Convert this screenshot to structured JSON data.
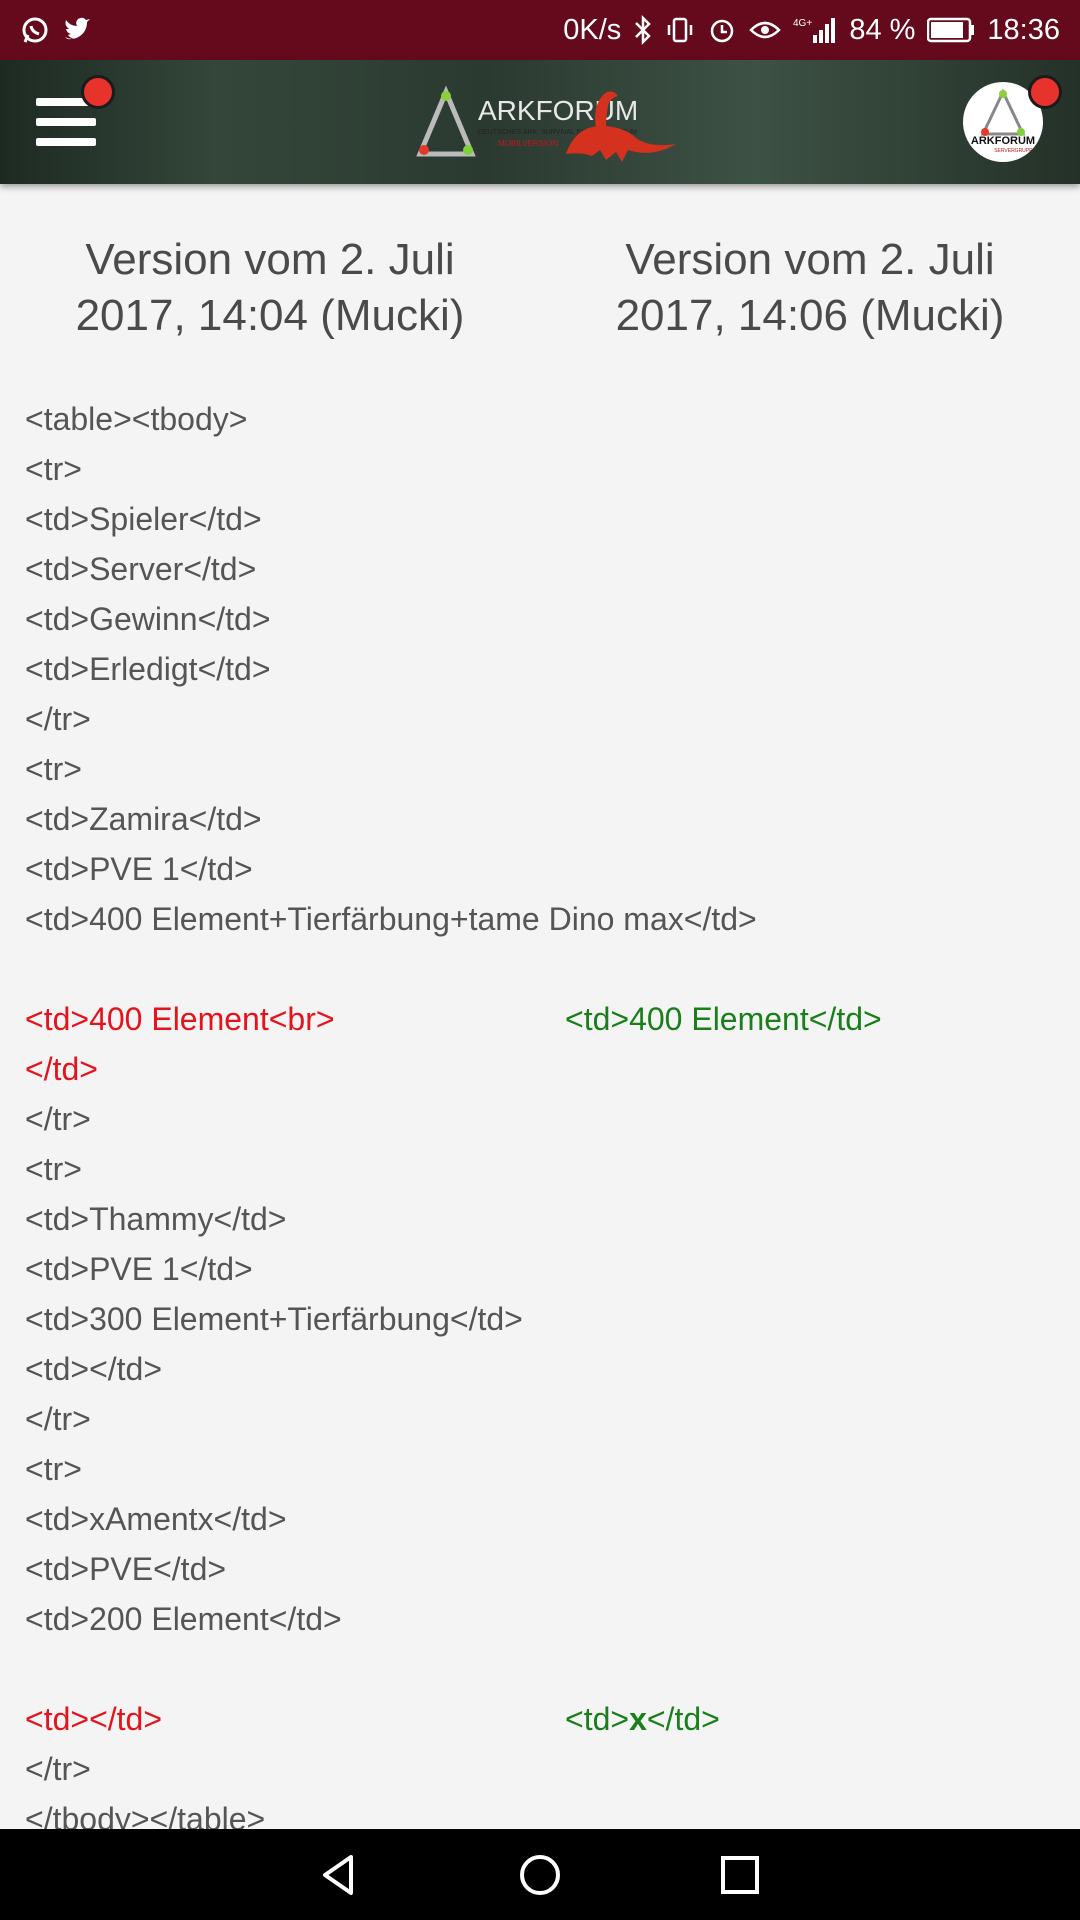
{
  "status_bar": {
    "left_icons": [
      "whatsapp-icon",
      "twitter-icon"
    ],
    "network_speed": "0K/s",
    "network_type": "4G+",
    "battery_percent": "84 %",
    "time": "18:36"
  },
  "header": {
    "logo_text": "ARKFORUM",
    "logo_tagline": "DEUTSCHES ARK: SURVIVAL EVOLVED FORUM",
    "logo_sub": "MOBILVERSION",
    "avatar_text": "ARKFORUM",
    "avatar_sub": "SERVERGRUPPE"
  },
  "diff": {
    "left_title": "Version vom 2. Juli 2017, 14:04 (Mucki)",
    "right_title": "Version vom 2. Juli 2017, 14:06 (Mucki)",
    "lines": [
      {
        "text": "<table><tbody>"
      },
      {
        "text": "<tr>"
      },
      {
        "text": "<td>Spieler</td>"
      },
      {
        "text": "<td>Server</td>"
      },
      {
        "text": "<td>Gewinn</td>"
      },
      {
        "text": "<td>Erledigt</td>"
      },
      {
        "text": "</tr>"
      },
      {
        "text": "<tr>"
      },
      {
        "text": "<td>Zamira</td>"
      },
      {
        "text": "<td>PVE 1</td>"
      },
      {
        "text": "<td>400 Element+Tierfärbung+tame Dino max</td>"
      },
      {
        "text": ""
      },
      {
        "removed": "<td>400 Element<br>",
        "added": "<td>400 Element</td>"
      },
      {
        "removed": "</td>"
      },
      {
        "text": "</tr>"
      },
      {
        "text": "<tr>"
      },
      {
        "text": "<td>Thammy</td>"
      },
      {
        "text": "<td>PVE 1</td>"
      },
      {
        "text": "<td>300 Element+Tierfärbung</td>"
      },
      {
        "text": "<td></td>"
      },
      {
        "text": "</tr>"
      },
      {
        "text": "<tr>"
      },
      {
        "text": "<td>xAmentx</td>"
      },
      {
        "text": "<td>PVE</td>"
      },
      {
        "text": "<td>200 Element</td>"
      },
      {
        "text": ""
      },
      {
        "removed": "<td></td>",
        "added_before": "<td>",
        "added_bold": "x",
        "added_after": "</td>"
      },
      {
        "text": "</tr>"
      },
      {
        "text": "</tbody></table>"
      }
    ]
  }
}
